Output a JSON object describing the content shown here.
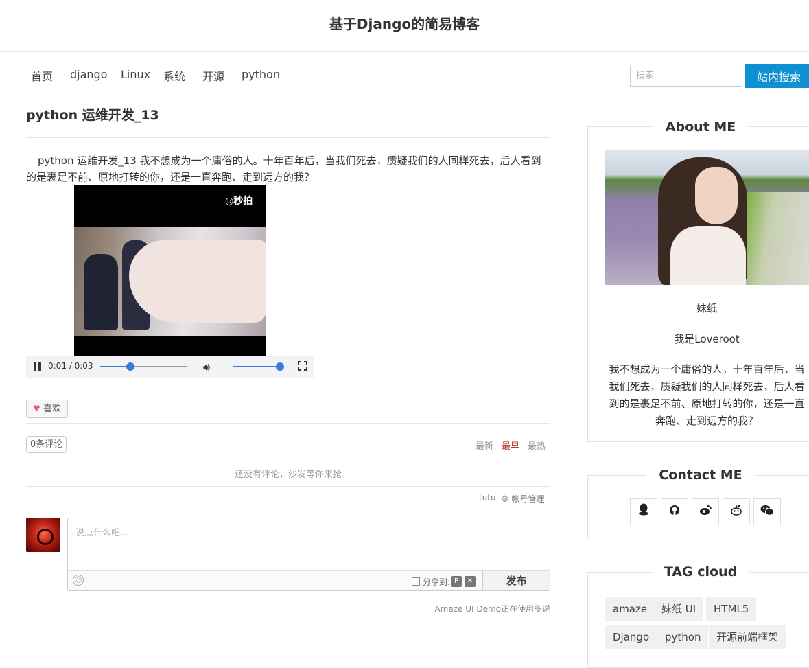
{
  "site": {
    "title": "基于Django的简易博客"
  },
  "nav": {
    "items": [
      "首页",
      "django",
      "Linux",
      "系统",
      "开源",
      "python"
    ],
    "search_placeholder": "搜索",
    "search_button": "站内搜索"
  },
  "post": {
    "title": "python 运维开发_13",
    "body": "python 运维开发_13 我不想成为一个庸俗的人。十年百年后，当我们死去，质疑我们的人同样死去，后人看到的是裹足不前、原地打转的你，还是一直奔跑、走到远方的我？",
    "video": {
      "watermark": "◎秒拍",
      "time": "0:01 / 0:03",
      "progress": 0.35,
      "volume": 1.0
    },
    "like_label": "喜欢"
  },
  "comments": {
    "count_label": "0条评论",
    "sort": [
      "最新",
      "最早",
      "最热"
    ],
    "active_sort": "最早",
    "empty_text": "还没有评论，沙发等你来抢",
    "user_name": "tutu",
    "account_label": "帐号管理",
    "input_placeholder": "说点什么吧…",
    "share_label": "分享到:",
    "publish_label": "发布",
    "powered_by": "Amaze UI Demo正在使用多说"
  },
  "sidebar": {
    "about": {
      "title": "About ME",
      "name": "妹纸",
      "subtitle": "我是Loveroot",
      "description": "我不想成为一个庸俗的人。十年百年后，当我们死去，质疑我们的人同样死去，后人看到的是裹足不前、原地打转的你，还是一直奔跑、走到远方的我？"
    },
    "contact": {
      "title": "Contact ME",
      "icons": [
        "qq-icon",
        "github-icon",
        "weibo-icon",
        "reddit-icon",
        "wechat-icon"
      ]
    },
    "tags": {
      "title": "TAG cloud",
      "items": [
        "amaze",
        "妹纸 UI",
        "HTML5",
        "Django",
        "python",
        "开源前端框架"
      ]
    }
  },
  "colors": {
    "accent": "#0e90d2",
    "active_sort": "#c0392b",
    "like_heart": "#e25c6d"
  }
}
